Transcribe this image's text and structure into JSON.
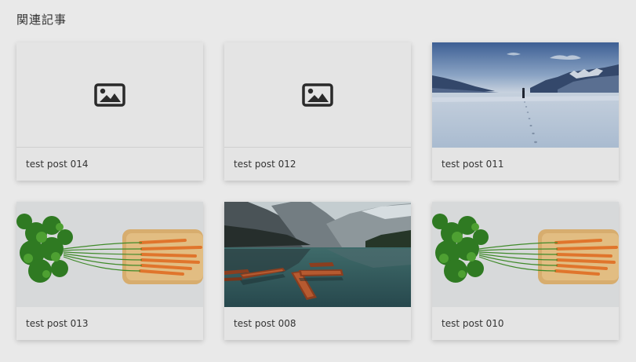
{
  "related": {
    "title": "関連記事",
    "cards": [
      {
        "label": "test post 014",
        "thumbnail": "image-placeholder-icon"
      },
      {
        "label": "test post 012",
        "thumbnail": "image-placeholder-icon"
      },
      {
        "label": "test post 011",
        "thumbnail": "snowfield-photo"
      },
      {
        "label": "test post 013",
        "thumbnail": "carrots-photo"
      },
      {
        "label": "test post 008",
        "thumbnail": "lake-boats-photo"
      },
      {
        "label": "test post 010",
        "thumbnail": "carrots-photo"
      }
    ]
  }
}
